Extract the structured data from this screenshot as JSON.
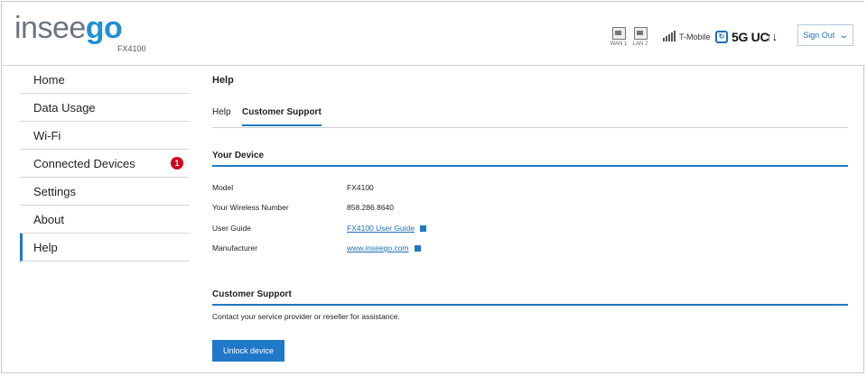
{
  "header": {
    "logo_part1": "insee",
    "logo_part2": "go",
    "model": "FX4100",
    "ports": [
      {
        "label": "WAN 1"
      },
      {
        "label": "LAN 2"
      }
    ],
    "carrier": "T-Mobile",
    "network": "5G UC",
    "signal_bars": 5,
    "sign_out_label": "Sign Out"
  },
  "sidebar": {
    "items": [
      {
        "label": "Home"
      },
      {
        "label": "Data Usage"
      },
      {
        "label": "Wi-Fi"
      },
      {
        "label": "Connected Devices",
        "badge": "1"
      },
      {
        "label": "Settings"
      },
      {
        "label": "About"
      },
      {
        "label": "Help",
        "active": true
      }
    ]
  },
  "main": {
    "page_title": "Help",
    "tabs": [
      {
        "label": "Help"
      },
      {
        "label": "Customer Support",
        "active": true
      }
    ],
    "device_section": {
      "title": "Your Device",
      "rows": [
        {
          "label": "Model",
          "value": "FX4100"
        },
        {
          "label": "Your Wireless Number",
          "value": "858.286.8640"
        },
        {
          "label": "User Guide",
          "value": "FX4100 User Guide",
          "link": true
        },
        {
          "label": "Manufacturer",
          "value": "www.inseego.com",
          "link": true
        }
      ]
    },
    "support_section": {
      "title": "Customer Support",
      "text": "Contact your service provider or reseller for assistance.",
      "button_label": "Unlock device"
    }
  },
  "colors": {
    "accent": "#1f78c8",
    "badge": "#d0021b",
    "logo_gray": "#6b7580",
    "logo_blue": "#1f8fd6"
  }
}
